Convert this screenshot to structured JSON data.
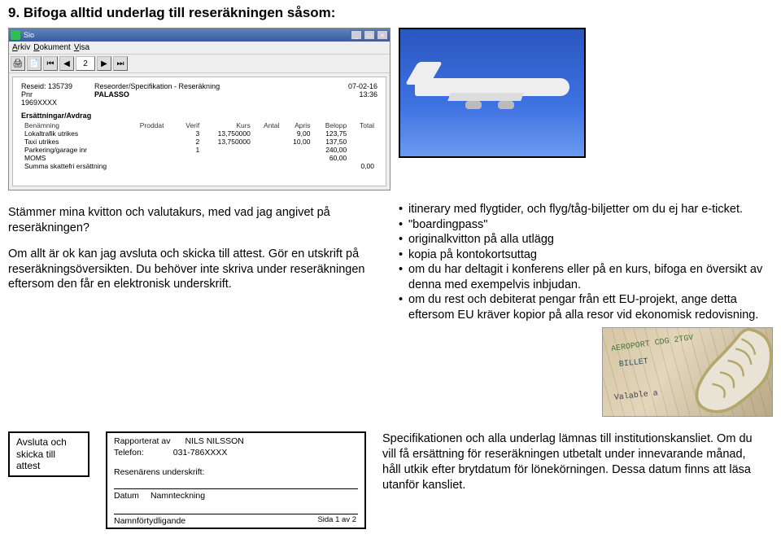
{
  "title": "9. Bifoga alltid underlag till reseräkningen såsom:",
  "app": {
    "name": "Sio",
    "menu": [
      "Arkiv",
      "Dokument",
      "Visa"
    ],
    "page_num": "2",
    "doc": {
      "reseid_lbl": "Reseid:",
      "reseid": "135739",
      "pnr_lbl": "Pnr",
      "pnr": "1969XXXX",
      "spec_title": "Reseorder/Specifikation - Reseräkning",
      "system": "PALASSO",
      "date": "07-02-16",
      "time": "13:36",
      "section": "Ersättningar/Avdrag",
      "headers": [
        "Benämning",
        "Proddat",
        "Verif",
        "Kurs",
        "Antal",
        "Apris",
        "Belopp",
        "Total"
      ],
      "rows": [
        {
          "ben": "Lokaltrafik utrikes",
          "proddat": "",
          "verif": "3",
          "kurs": "13,750000",
          "antal": "",
          "apris": "9,00",
          "belopp": "123,75",
          "total": ""
        },
        {
          "ben": "Taxi utrikes",
          "proddat": "",
          "verif": "2",
          "kurs": "13,750000",
          "antal": "",
          "apris": "10,00",
          "belopp": "137,50",
          "total": ""
        },
        {
          "ben": "Parkering/garage inr",
          "proddat": "",
          "verif": "1",
          "kurs": "",
          "antal": "",
          "apris": "",
          "belopp": "240,00",
          "total": ""
        },
        {
          "ben": "MOMS",
          "proddat": "",
          "verif": "",
          "kurs": "",
          "antal": "",
          "apris": "",
          "belopp": "60,00",
          "total": ""
        },
        {
          "ben": "Summa skattefri ersättning",
          "proddat": "",
          "verif": "",
          "kurs": "",
          "antal": "",
          "apris": "",
          "belopp": "",
          "total": "0,00"
        }
      ]
    }
  },
  "left": {
    "p1": "Stämmer mina kvitton och valutakurs, med vad jag angivet på reseräkningen?",
    "p2": "Om allt är ok kan jag avsluta och skicka till attest. Gör en utskrift på reseräkningsöversikten. Du behöver inte skriva under reseräkningen eftersom den får en elektronisk underskrift."
  },
  "right": {
    "bullets": [
      "itinerary med flygtider, och flyg/tåg-biljetter om du ej har e-ticket.",
      "\"boardingpass\"",
      "originalkvitton på alla utlägg",
      "kopia på kontokortsuttag",
      "om du har deltagit i konferens eller på en kurs, bifoga en översikt av denna med exempelvis inbjudan.",
      "om du rest och debiterat pengar från ett EU-projekt, ange detta eftersom EU kräver kopior på alla resor vid ekonomisk redovisning."
    ],
    "ticket_lines": [
      "AEROPORT CDG 2TGV",
      "BILLET",
      "Valable a"
    ]
  },
  "button": {
    "line1": "Avsluta och",
    "line2": "skicka till attest"
  },
  "sig": {
    "rapporterat": "Rapporterat av",
    "telefon": "Telefon:",
    "name": "NILS NILSSON",
    "phone": "031-786XXXX",
    "resenar": "Resenärens underskrift:",
    "datum": "Datum",
    "namn": "Namnteckning",
    "fortyd": "Namnförtydligande",
    "sida": "Sida 1 av 2"
  },
  "spec": "Specifikationen och alla underlag lämnas till institutionskansliet. Om du vill få ersättning för reseräkningen utbetalt under innevarande månad, håll utkik efter brytdatum för lönekörningen. Dessa datum finns att läsa utanför kansliet."
}
